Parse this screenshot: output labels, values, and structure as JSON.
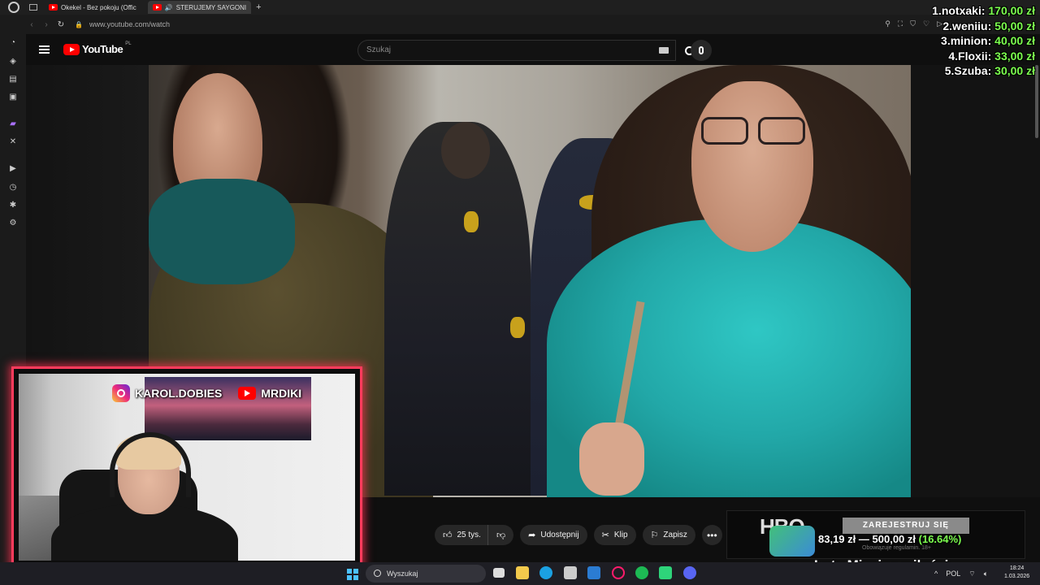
{
  "browser": {
    "tabs": [
      {
        "title": "Okekel - Bez pokoju (Offic",
        "active": false
      },
      {
        "title": "STERUJEMY SAYGONI",
        "active": true
      }
    ],
    "url": "www.youtube.com/watch"
  },
  "youtube": {
    "logo_text": "YouTube",
    "region": "PL",
    "search_placeholder": "Szukaj",
    "actions": {
      "like_count": "25 tys.",
      "share": "Udostępnij",
      "clip": "Klip",
      "save": "Zapisz"
    }
  },
  "overlay": {
    "instagram": "KAROL.DOBIES",
    "youtube": "MRDIKI",
    "leaderboard": [
      {
        "rank_name": "1.notxaki:",
        "amount": "170,00 zł"
      },
      {
        "rank_name": "2.weniiu:",
        "amount": "50,00 zł"
      },
      {
        "rank_name": "3.minion:",
        "amount": "40,00 zł"
      },
      {
        "rank_name": "4.Floxii:",
        "amount": "33,00 zł"
      },
      {
        "rank_name": "5.Szuba:",
        "amount": "30,00 zł"
      }
    ],
    "ad": {
      "brand": "HBO",
      "cta": "ZAREJESTRUJ SIĘ",
      "fine_print": "Obowiązuje regulamin. 18+"
    },
    "goal": {
      "current": "83,19 zł",
      "target": "500,00 zł",
      "percent": "(16.64%)"
    },
    "caption": "Luty Miesiąc miłości"
  },
  "taskbar": {
    "search_placeholder": "Wyszukaj",
    "language": "POL",
    "time": "18:24",
    "date": "1.03.2026"
  },
  "colors": {
    "webcam_border": "#ff3b5c",
    "donation_green": "#7cff4f",
    "youtube_red": "#ff0000"
  }
}
